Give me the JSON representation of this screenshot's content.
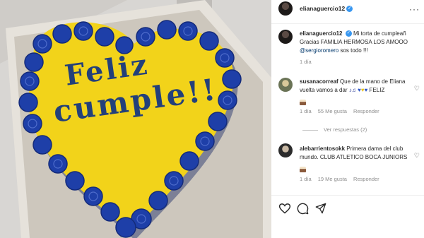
{
  "post": {
    "author": "elianaguercio12",
    "caption_username": "elianaguercio12",
    "caption_line1": "Mi torta de cumpleañ",
    "caption_line2": "Gracias FAMILIA HERMOSA LOS AMOOO",
    "caption_mention": "@sergioromero",
    "caption_line3_rest": " sos todo !!!",
    "caption_time": "1 día"
  },
  "photo": {
    "cake_line1": "Feliz",
    "cake_line2": "cumple!!",
    "colors": {
      "cake_yellow": "#f2d31a",
      "roses_blue": "#1e3fa8",
      "box": "#d9d6d0"
    }
  },
  "comments": [
    {
      "username": "susanacorreaf",
      "line1": "Que de la mano de Eliana",
      "line2": "vuelta vamos a dar",
      "line2_tail": "FELIZ",
      "time": "1 día",
      "likes": "55 Me gusta",
      "reply": "Responder",
      "view_replies": "Ver respuestas (2)"
    },
    {
      "username": "alebarrientosokk",
      "line1": "Primera dama del club",
      "line2": "mundo. CLUB ATLETICO BOCA JUNIORS",
      "time": "1 día",
      "likes": "19 Me gusta",
      "reply": "Responder"
    }
  ],
  "icons": [
    "more-options-icon",
    "verified-icon",
    "heart-icon",
    "comment-icon",
    "share-icon"
  ]
}
